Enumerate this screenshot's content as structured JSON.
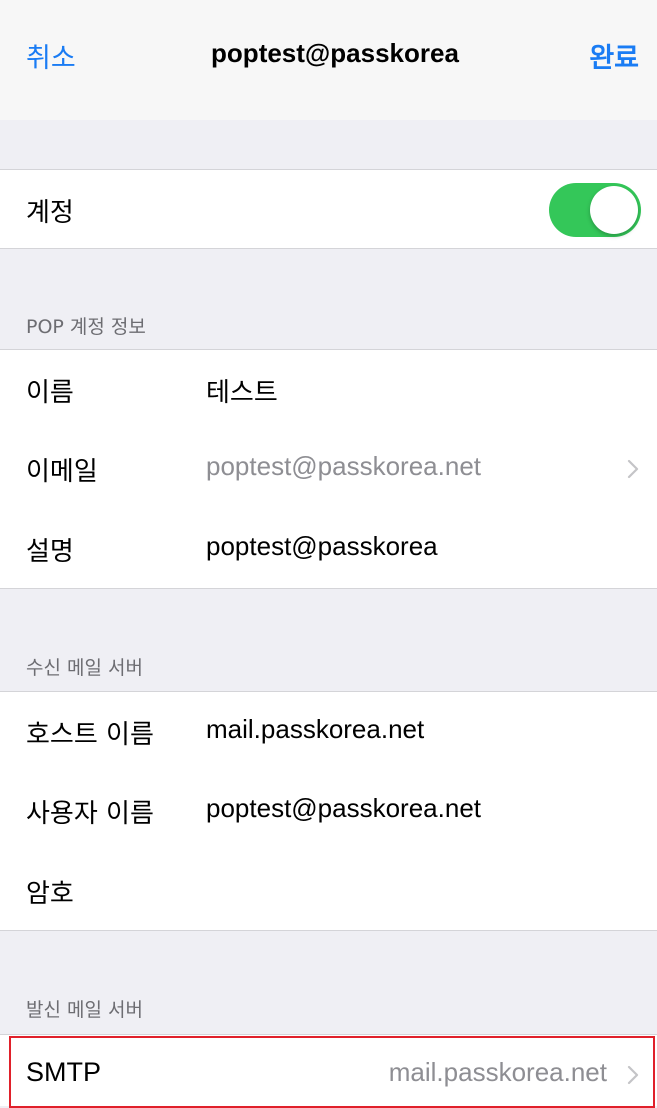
{
  "nav": {
    "cancel_label": "취소",
    "title": "poptest@passkorea",
    "done_label": "완료"
  },
  "account_toggle": {
    "label": "계정",
    "state": "on",
    "color": "#34c759"
  },
  "pop_section": {
    "header": "POP 계정 정보",
    "rows": [
      {
        "label": "이름",
        "value": "테스트"
      },
      {
        "label": "이메일",
        "value": "poptest@passkorea.net"
      },
      {
        "label": "설명",
        "value": "poptest@passkorea"
      }
    ]
  },
  "incoming_section": {
    "header": "수신 메일 서버",
    "rows": [
      {
        "label": "호스트 이름",
        "value": "mail.passkorea.net"
      },
      {
        "label": "사용자 이름",
        "value": "poptest@passkorea.net"
      },
      {
        "label": "암호",
        "value": ""
      }
    ]
  },
  "outgoing_section": {
    "header": "발신 메일 서버",
    "rows": [
      {
        "label": "SMTP",
        "value": "mail.passkorea.net"
      }
    ]
  },
  "colors": {
    "accent": "#1a7cf4",
    "background": "#efeff4",
    "highlight": "#e0202a"
  }
}
